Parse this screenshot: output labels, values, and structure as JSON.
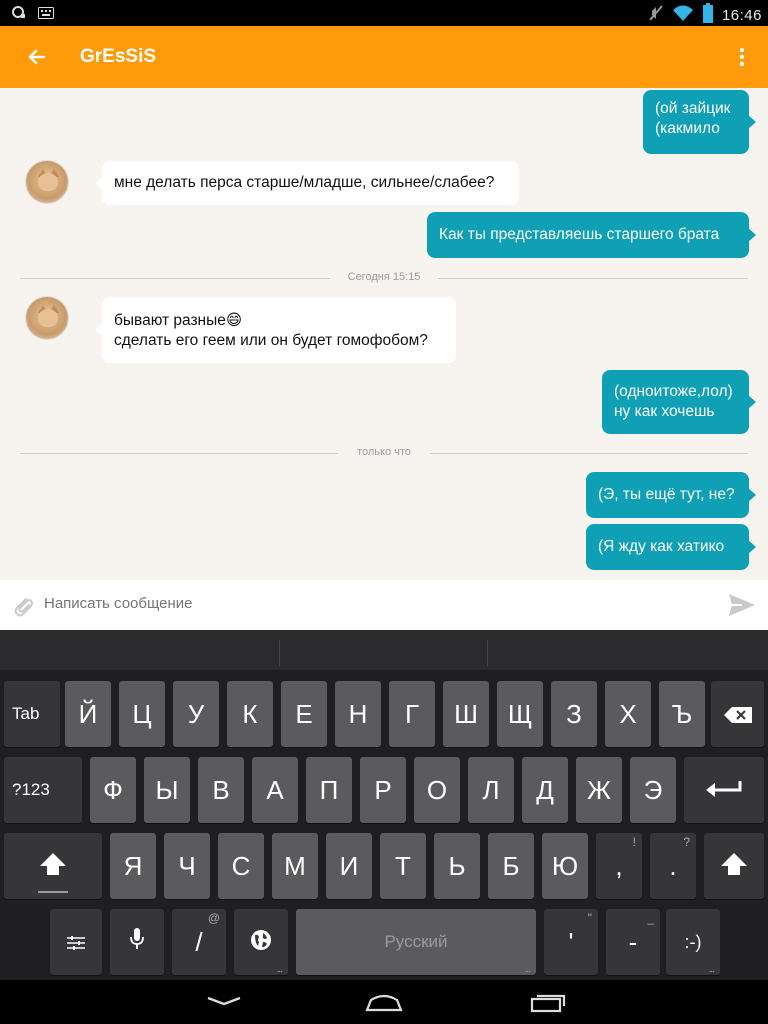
{
  "status_bar": {
    "time": "16:46",
    "left_icons": [
      "notification-icon",
      "keyboard-icon"
    ],
    "right_icons": [
      "mute-icon",
      "wifi-icon",
      "battery-icon"
    ]
  },
  "app_bar": {
    "title": "GrEsSiS",
    "back_icon": "arrow-left-icon",
    "menu_icon": "more-vert-icon"
  },
  "chat": {
    "messages": [
      {
        "direction": "out",
        "text": "(ой зайцик\n(какмило"
      },
      {
        "direction": "in",
        "text": "мне делать перса старше/младше, сильнее/слабее?"
      },
      {
        "direction": "out",
        "text": "Как ты представляешь старшего брата"
      },
      {
        "direction": "in",
        "text": "бывают разные😄\nсделать его геем или он будет гомофобом?"
      },
      {
        "direction": "out",
        "text": "(однoитоже,лол)\nну как хочешь"
      },
      {
        "direction": "out",
        "text": "(Э, ты ещё тут, не?"
      },
      {
        "direction": "out",
        "text": "(Я жду как хатико"
      }
    ],
    "dividers": [
      "Сегодня 15:15",
      "только что"
    ]
  },
  "composer": {
    "placeholder": "Написать сообщение",
    "attach_icon": "paperclip-icon",
    "send_icon": "send-icon"
  },
  "keyboard": {
    "row1": [
      "Tab",
      "Й",
      "Ц",
      "У",
      "К",
      "Е",
      "Н",
      "Г",
      "Ш",
      "Щ",
      "З",
      "Х",
      "Ъ"
    ],
    "row2": [
      "?123",
      "Ф",
      "Ы",
      "В",
      "А",
      "П",
      "Р",
      "О",
      "Л",
      "Д",
      "Ж",
      "Э"
    ],
    "row3": [
      "Я",
      "Ч",
      "С",
      "М",
      "И",
      "Т",
      "Ь",
      "Б",
      "Ю",
      ",",
      "."
    ],
    "row3_hints": [
      "!",
      "?"
    ],
    "row4": {
      "slash": "/",
      "slash_hint": "@",
      "space": "Русский",
      "apostrophe": "'",
      "apostrophe_hint": "\"",
      "dash": "-",
      "dash_hint": "_",
      "smiley": ":-)"
    }
  }
}
